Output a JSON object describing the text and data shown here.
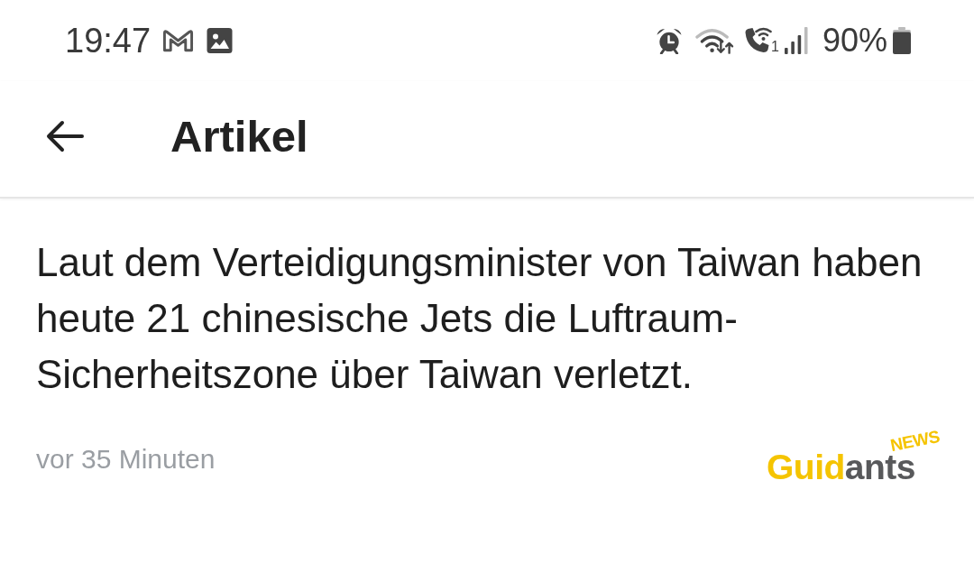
{
  "status_bar": {
    "time": "19:47",
    "call_sim": "1",
    "battery_text": "90%"
  },
  "app_bar": {
    "title": "Artikel"
  },
  "article": {
    "text": "Laut dem Verteidigungsminister von Taiwan haben heute 21 chinesische Jets die Luftraum-Sicherheitszone über Taiwan verletzt.",
    "time_ago": "vor 35 Minuten",
    "source_logo": {
      "wordmark": [
        {
          "text": "Guid",
          "color": "#f5c400"
        },
        {
          "text": "ants",
          "color": "#58595b"
        }
      ],
      "tag": "NEWS"
    }
  }
}
